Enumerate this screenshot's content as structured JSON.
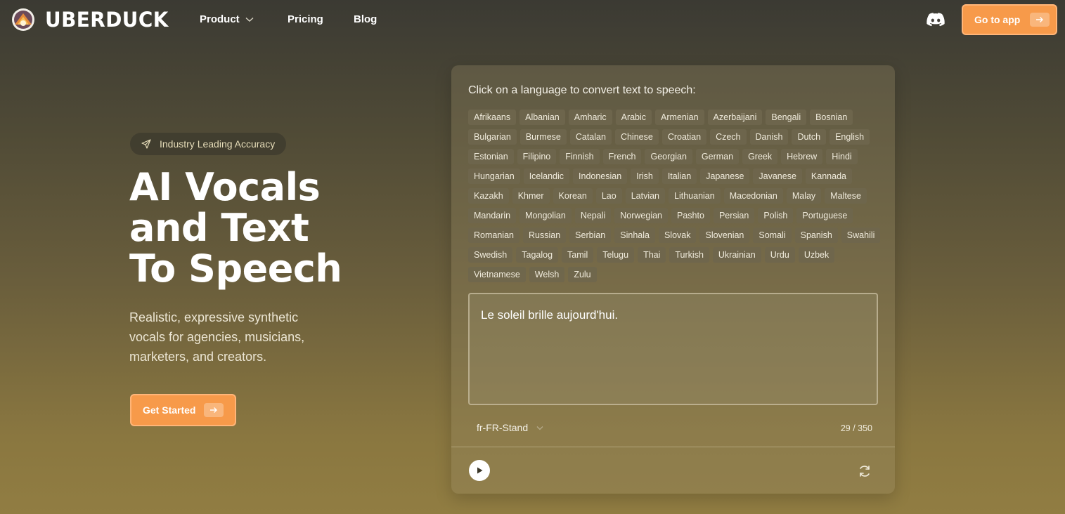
{
  "header": {
    "brand": "UBERDUCK",
    "nav": [
      {
        "label": "Product",
        "has_dropdown": true
      },
      {
        "label": "Pricing"
      },
      {
        "label": "Blog"
      }
    ],
    "cta_label": "Go to app",
    "accent_color": "#f79a4a"
  },
  "hero": {
    "pill_text": "Industry Leading Accuracy",
    "title_lines": [
      "AI Vocals",
      "and Text",
      "To Speech"
    ],
    "subtitle": "Realistic, expressive synthetic vocals for agencies, musicians, marketers, and creators.",
    "cta_label": "Get Started"
  },
  "tts_card": {
    "heading": "Click on a language to convert text to speech:",
    "languages": [
      "Afrikaans",
      "Albanian",
      "Amharic",
      "Arabic",
      "Armenian",
      "Azerbaijani",
      "Bengali",
      "Bosnian",
      "Bulgarian",
      "Burmese",
      "Catalan",
      "Chinese",
      "Croatian",
      "Czech",
      "Danish",
      "Dutch",
      "English",
      "Estonian",
      "Filipino",
      "Finnish",
      "French",
      "Georgian",
      "German",
      "Greek",
      "Hebrew",
      "Hindi",
      "Hungarian",
      "Icelandic",
      "Indonesian",
      "Irish",
      "Italian",
      "Japanese",
      "Javanese",
      "Kannada",
      "Kazakh",
      "Khmer",
      "Korean",
      "Lao",
      "Latvian",
      "Lithuanian",
      "Macedonian",
      "Malay",
      "Maltese",
      "Mandarin",
      "Mongolian",
      "Nepali",
      "Norwegian",
      "Pashto",
      "Persian",
      "Polish",
      "Portuguese",
      "Romanian",
      "Russian",
      "Serbian",
      "Sinhala",
      "Slovak",
      "Slovenian",
      "Somali",
      "Spanish",
      "Swahili",
      "Swedish",
      "Tagalog",
      "Tamil",
      "Telugu",
      "Thai",
      "Turkish",
      "Ukrainian",
      "Urdu",
      "Uzbek",
      "Vietnamese",
      "Welsh",
      "Zulu"
    ],
    "text_value": "Le soleil brille aujourd'hui.",
    "voice_value": "fr-FR-Stand",
    "char_count": "29 / 350"
  },
  "icons": {
    "logo": "uberduck-logo-icon",
    "discord": "discord-icon",
    "arrow": "arrow-right-icon",
    "play": "play-icon",
    "refresh": "refresh-icon",
    "send": "send-icon"
  }
}
